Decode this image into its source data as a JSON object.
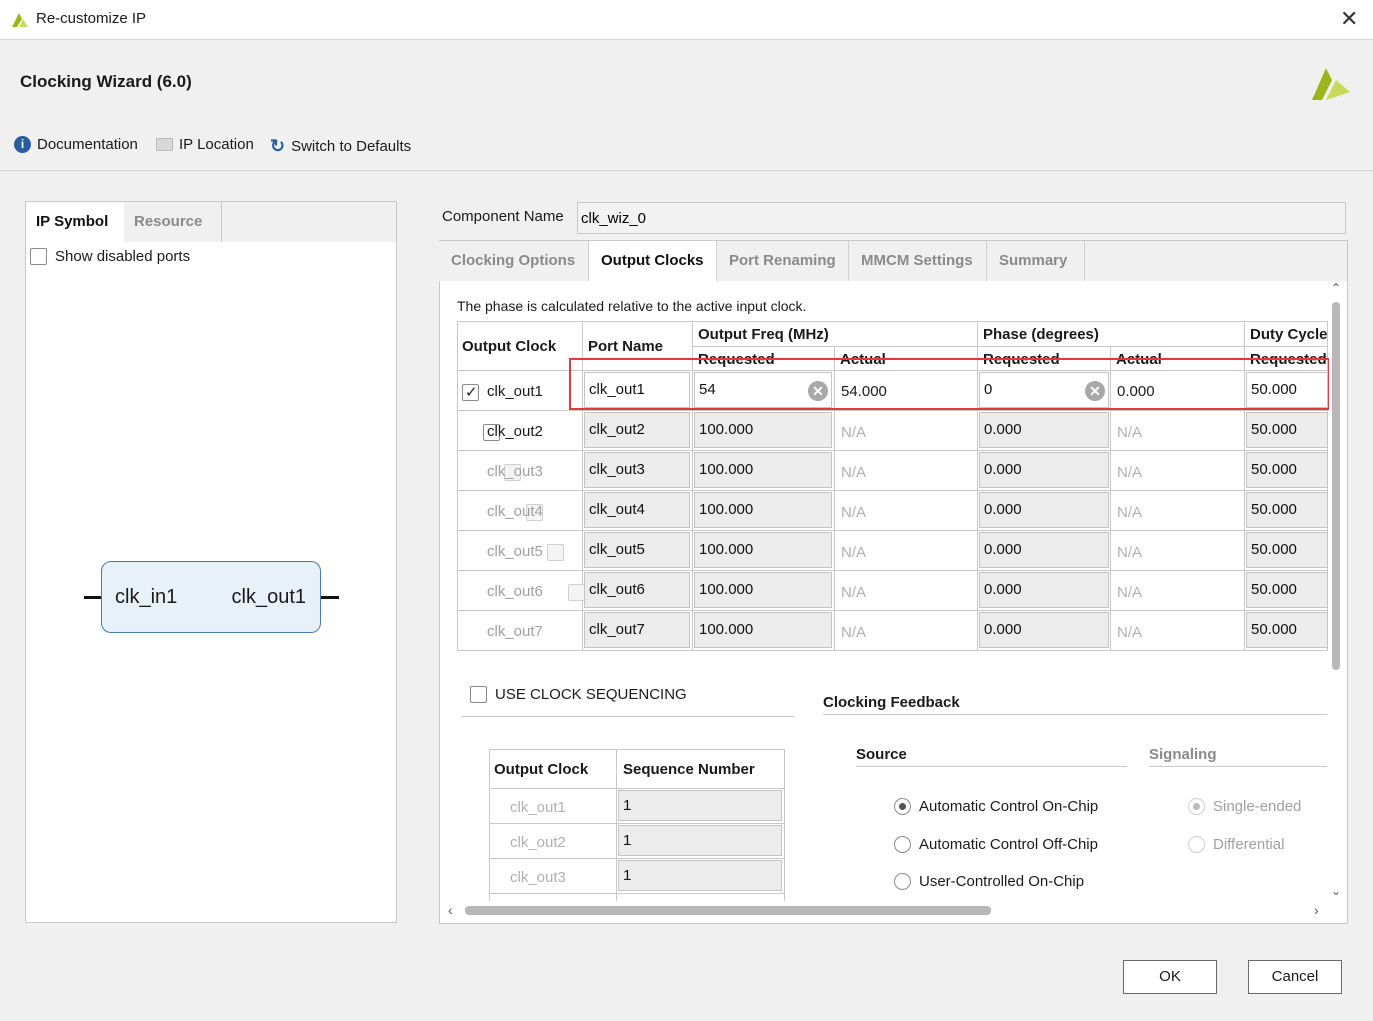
{
  "window": {
    "title": "Re-customize IP"
  },
  "header": {
    "wizard_title": "Clocking Wizard (6.0)"
  },
  "toolbar": {
    "documentation": "Documentation",
    "ip_location": "IP Location",
    "switch_defaults": "Switch to Defaults"
  },
  "left": {
    "tabs": [
      "IP Symbol",
      "Resource"
    ],
    "show_disabled_ports": "Show disabled ports",
    "symbol": {
      "input_port": "clk_in1",
      "output_port": "clk_out1"
    }
  },
  "component": {
    "label": "Component Name",
    "value": "clk_wiz_0"
  },
  "tabs": [
    "Clocking Options",
    "Output Clocks",
    "Port Renaming",
    "MMCM Settings",
    "Summary"
  ],
  "output_clocks": {
    "note": "The phase is calculated relative to the active input clock.",
    "headers": {
      "output_clock": "Output Clock",
      "port_name": "Port Name",
      "output_freq": "Output Freq (MHz)",
      "phase": "Phase (degrees)",
      "duty_cycle": "Duty Cycle",
      "requested": "Requested",
      "actual": "Actual"
    },
    "rows": [
      {
        "name": "clk_out1",
        "port": "clk_out1",
        "freq_req": "54",
        "freq_act": "54.000",
        "phase_req": "0",
        "phase_act": "0.000",
        "duty": "50.000"
      },
      {
        "name": "clk_out2",
        "port": "clk_out2",
        "freq_req": "100.000",
        "freq_act": "N/A",
        "phase_req": "0.000",
        "phase_act": "N/A",
        "duty": "50.000"
      },
      {
        "name": "clk_out3",
        "port": "clk_out3",
        "freq_req": "100.000",
        "freq_act": "N/A",
        "phase_req": "0.000",
        "phase_act": "N/A",
        "duty": "50.000"
      },
      {
        "name": "clk_out4",
        "port": "clk_out4",
        "freq_req": "100.000",
        "freq_act": "N/A",
        "phase_req": "0.000",
        "phase_act": "N/A",
        "duty": "50.000"
      },
      {
        "name": "clk_out5",
        "port": "clk_out5",
        "freq_req": "100.000",
        "freq_act": "N/A",
        "phase_req": "0.000",
        "phase_act": "N/A",
        "duty": "50.000"
      },
      {
        "name": "clk_out6",
        "port": "clk_out6",
        "freq_req": "100.000",
        "freq_act": "N/A",
        "phase_req": "0.000",
        "phase_act": "N/A",
        "duty": "50.000"
      },
      {
        "name": "clk_out7",
        "port": "clk_out7",
        "freq_req": "100.000",
        "freq_act": "N/A",
        "phase_req": "0.000",
        "phase_act": "N/A",
        "duty": "50.000"
      }
    ]
  },
  "sequencing": {
    "label": "USE CLOCK SEQUENCING",
    "headers": [
      "Output Clock",
      "Sequence Number"
    ],
    "rows": [
      {
        "clock": "clk_out1",
        "seq": "1"
      },
      {
        "clock": "clk_out2",
        "seq": "1"
      },
      {
        "clock": "clk_out3",
        "seq": "1"
      }
    ]
  },
  "feedback": {
    "title": "Clocking Feedback",
    "source_label": "Source",
    "signaling_label": "Signaling",
    "sources": [
      "Automatic Control On-Chip",
      "Automatic Control Off-Chip",
      "User-Controlled On-Chip"
    ],
    "signaling": [
      "Single-ended",
      "Differential"
    ]
  },
  "buttons": {
    "ok": "OK",
    "cancel": "Cancel"
  },
  "colors": {
    "highlight_box": "#e03a3a",
    "xilinx_logo": "#9db51d"
  }
}
